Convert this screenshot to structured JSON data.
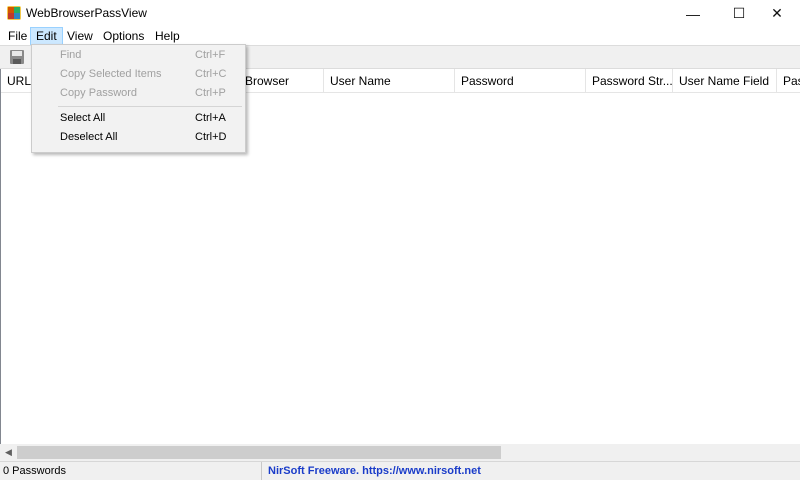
{
  "window": {
    "title": "WebBrowserPassView",
    "minimize_glyph": "—",
    "maximize_glyph": "☐",
    "close_glyph": "✕"
  },
  "menubar": {
    "items": [
      {
        "label": "File"
      },
      {
        "label": "Edit"
      },
      {
        "label": "View"
      },
      {
        "label": "Options"
      },
      {
        "label": "Help"
      }
    ]
  },
  "edit_menu": {
    "items": [
      {
        "label": "Find",
        "shortcut": "Ctrl+F",
        "enabled": false
      },
      {
        "label": "Copy Selected Items",
        "shortcut": "Ctrl+C",
        "enabled": false
      },
      {
        "label": "Copy Password",
        "shortcut": "Ctrl+P",
        "enabled": false
      },
      {
        "label": "Select All",
        "shortcut": "Ctrl+A",
        "enabled": true
      },
      {
        "label": "Deselect All",
        "shortcut": "Ctrl+D",
        "enabled": true
      }
    ]
  },
  "list": {
    "columns": [
      {
        "label": "URL"
      },
      {
        "label": "Web Browser",
        "visible_text": "b Browser"
      },
      {
        "label": "User Name"
      },
      {
        "label": "Password"
      },
      {
        "label": "Password Str..."
      },
      {
        "label": "User Name Field"
      },
      {
        "label": "Pas"
      }
    ],
    "rows": []
  },
  "statusbar": {
    "count_text": "0 Passwords",
    "credit_text": "NirSoft Freeware. https://www.nirsoft.net"
  },
  "colors": {
    "menu_active_bg": "#cce8ff",
    "link_blue": "#1a3cc9",
    "disabled_text": "#a0a0a0"
  },
  "icons": {
    "app": "webbrowserpassview-app-icon",
    "save": "save-icon",
    "scroll_left": "scroll-left-arrow-icon"
  }
}
